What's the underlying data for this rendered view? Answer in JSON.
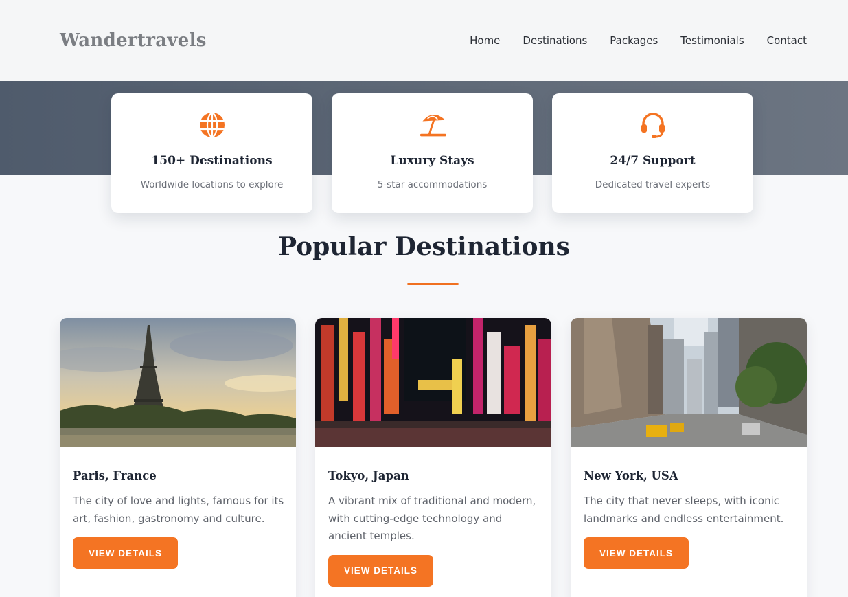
{
  "brand": "Wandertravels",
  "nav": [
    "Home",
    "Destinations",
    "Packages",
    "Testimonials",
    "Contact"
  ],
  "features": [
    {
      "icon": "globe-icon",
      "title": "150+ Destinations",
      "desc": "Worldwide locations to explore"
    },
    {
      "icon": "beach-umbrella-icon",
      "title": "Luxury Stays",
      "desc": "5-star accommodations"
    },
    {
      "icon": "headset-icon",
      "title": "24/7 Support",
      "desc": "Dedicated travel experts"
    }
  ],
  "section_title": "Popular Destinations",
  "destinations": [
    {
      "name": "Paris, France",
      "desc": "The city of love and lights, famous for its art, fashion, gastronomy and culture.",
      "button": "VIEW DETAILS",
      "image": "eiffel-tower-photo"
    },
    {
      "name": "Tokyo, Japan",
      "desc": "A vibrant mix of traditional and modern, with cutting-edge technology and ancient temples.",
      "button": "VIEW DETAILS",
      "image": "tokyo-neon-street-photo"
    },
    {
      "name": "New York, USA",
      "desc": "The city that never sleeps, with iconic landmarks and endless entertainment.",
      "button": "VIEW DETAILS",
      "image": "new-york-street-photo"
    }
  ],
  "colors": {
    "accent": "#f47423",
    "dark": "#1e2533",
    "band": "#5a6575"
  }
}
